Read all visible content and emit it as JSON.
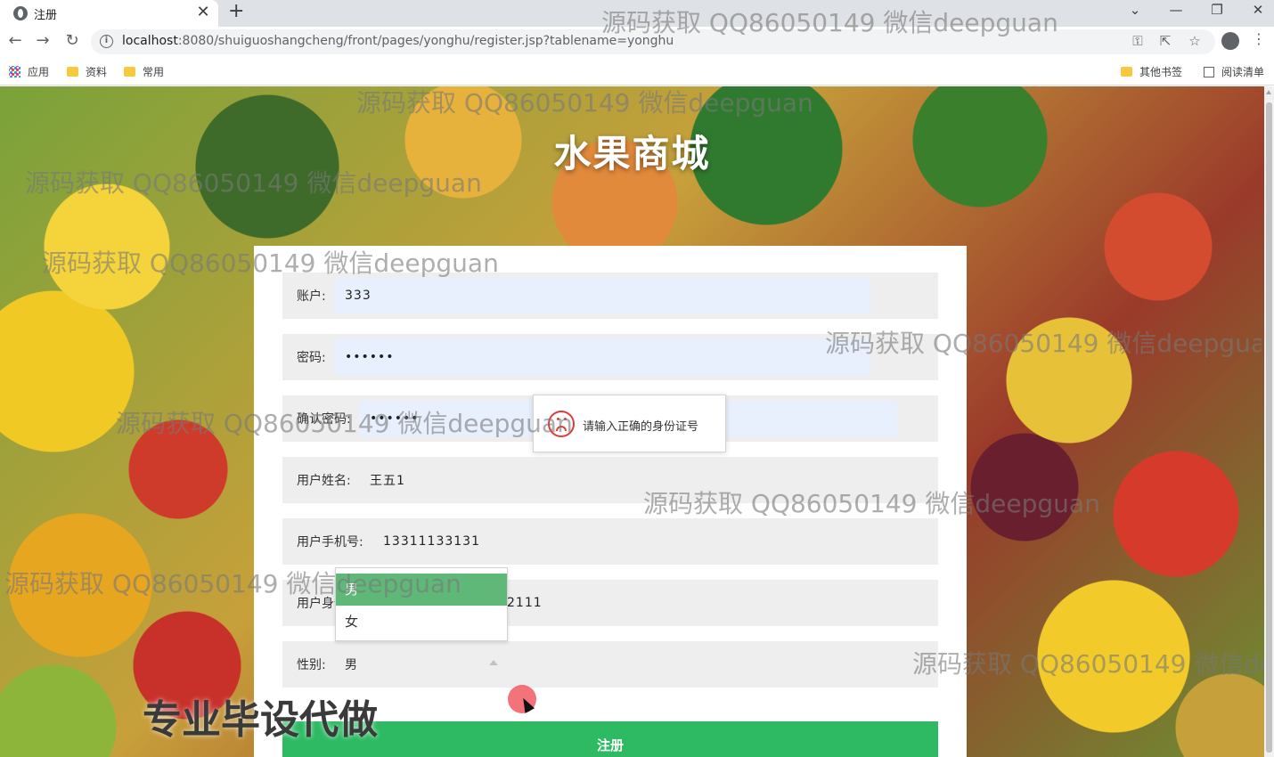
{
  "browser": {
    "tab_title": "注册",
    "tab_close": "✕",
    "new_tab": "+",
    "url_host": "localhost",
    "url_path": ":8080/shuiguoshangcheng/front/pages/yonghu/register.jsp?tablename=yonghu",
    "window_controls": [
      "⌄",
      "—",
      "❐",
      "✕"
    ],
    "bookmarks": [
      "应用",
      "资料",
      "常用"
    ],
    "bookmarks_right": [
      "其他书签",
      "阅读清单"
    ]
  },
  "site": {
    "title": "水果商城"
  },
  "form": {
    "account": {
      "label": "账户:",
      "value": "333"
    },
    "password": {
      "label": "密码:",
      "value": "••••••"
    },
    "confirm_password": {
      "label": "确认密码:",
      "value": "••••••"
    },
    "name": {
      "label": "用户姓名:",
      "value": "王五1"
    },
    "phone": {
      "label": "用户手机号:",
      "value": "13311133131"
    },
    "id_card": {
      "label": "用户身份证:",
      "value": "2111"
    },
    "gender": {
      "label": "性别:",
      "value": "男",
      "options": [
        "男",
        "女"
      ],
      "selected": "男"
    },
    "submit_label": "注册"
  },
  "toast": {
    "message": "请输入正确的身份证号"
  },
  "watermark": "源码获取 QQ86050149 微信deepguan",
  "promo_text": "专业毕设代做",
  "colors": {
    "accent_green": "#2dba62",
    "selected_option": "#5fb878",
    "error_red": "#e23a3a"
  }
}
